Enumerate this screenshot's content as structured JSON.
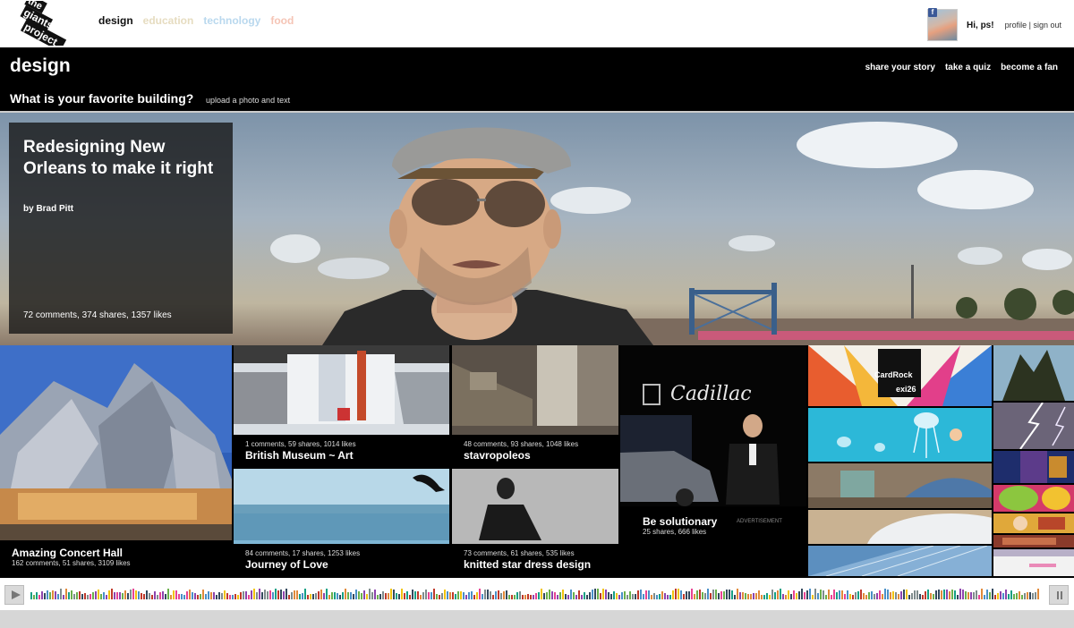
{
  "site": {
    "logo_text": [
      "the",
      "giants",
      "project"
    ]
  },
  "nav": {
    "items": [
      "design",
      "education",
      "technology",
      "food"
    ]
  },
  "user": {
    "greeting": "Hi, ps!",
    "profile_link": "profile",
    "separator": "|",
    "signout_link": "sign out"
  },
  "category": {
    "title": "design",
    "question": "What is your favorite building?",
    "upload_link": "upload a photo and text",
    "actions": [
      "share your story",
      "take a quiz",
      "become a fan"
    ]
  },
  "hero": {
    "title": "Redesigning New Orleans to make it right",
    "author": "by Brad Pitt",
    "stats": "72 comments, 374 shares, 1357 likes"
  },
  "tiles": [
    {
      "title": "Amazing Concert Hall",
      "stats": "162 comments, 51 shares, 3109 likes"
    },
    {
      "title": "British Museum ~ Art",
      "stats": "1 comments, 59 shares, 1014 likes"
    },
    {
      "title": "stavropoleos",
      "stats": "48 comments, 93 shares, 1048 likes"
    },
    {
      "title": "Journey of Love",
      "stats": "84 comments, 17 shares, 1253 likes"
    },
    {
      "title": "knitted star dress design",
      "stats": "73 comments, 61 shares, 535 likes"
    }
  ],
  "ad": {
    "brand": "Cadillac",
    "title": "Be solutionary",
    "stats": "25 shares, 666 likes",
    "label": "ADVERTISEMENT"
  },
  "mosaic": {
    "cardrock_text": "CardRock",
    "cardrock_sub": "exi26"
  },
  "colors": {
    "header_bg": "#000000",
    "nav_active": "#111111",
    "nav_education": "#e6dcc0",
    "nav_technology": "#b9d8ee",
    "nav_food": "#f5c4b5",
    "footer_gray": "#d6d6d6"
  },
  "icons": {
    "play": "play-icon",
    "pause": "pause-icon",
    "facebook": "facebook-icon"
  }
}
